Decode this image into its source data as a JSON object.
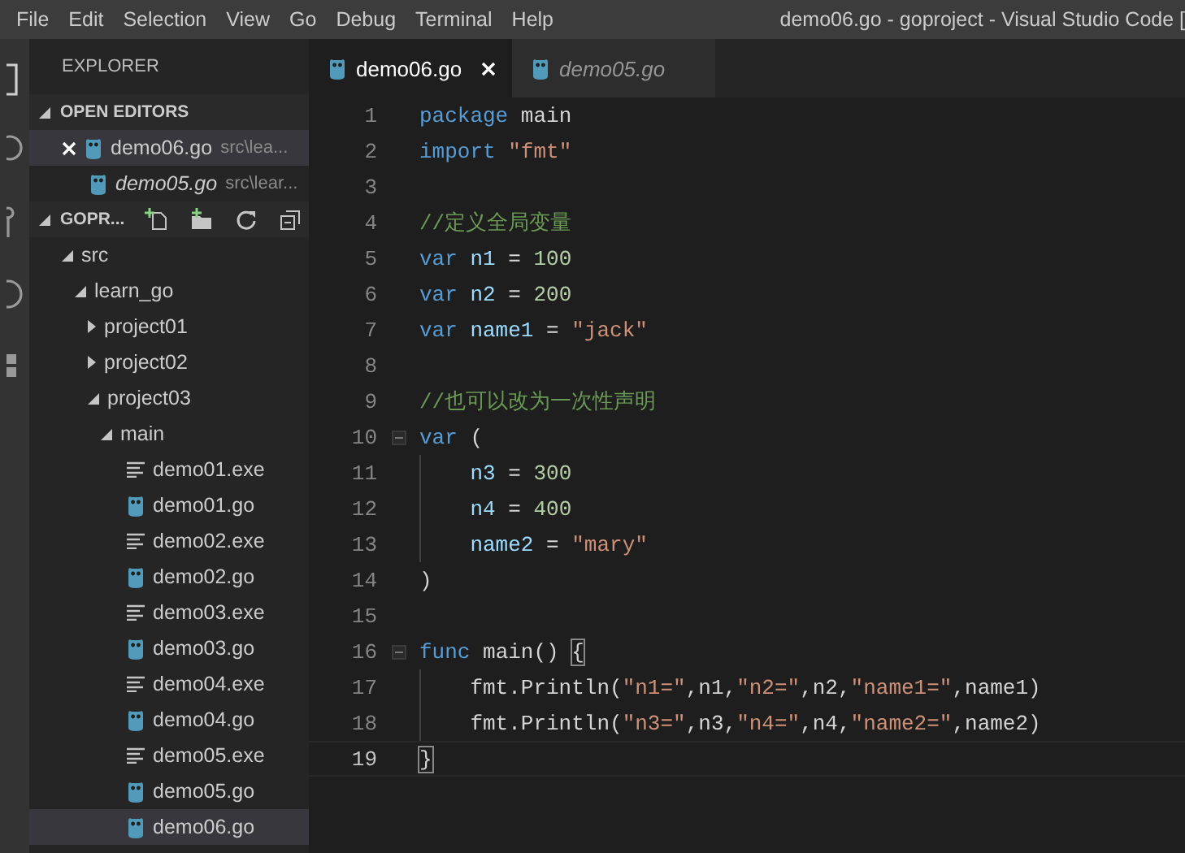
{
  "menu": [
    "File",
    "Edit",
    "Selection",
    "View",
    "Go",
    "Debug",
    "Terminal",
    "Help"
  ],
  "window": {
    "title": "demo06.go - goproject - Visual Studio Code ["
  },
  "sidebar": {
    "title": "EXPLORER",
    "open_editors": {
      "title": "OPEN EDITORS",
      "expanded": true,
      "items": [
        {
          "name": "demo06.go",
          "path": "src\\lea...",
          "selected": true,
          "preview": false
        },
        {
          "name": "demo05.go",
          "path": "src\\lear...",
          "selected": false,
          "preview": true
        }
      ]
    },
    "folder": {
      "title": "GOPR...",
      "expanded": true,
      "tree": [
        {
          "name": "src",
          "kind": "folder",
          "expanded": true,
          "selected": false,
          "children": [
            {
              "name": "learn_go",
              "kind": "folder",
              "expanded": true,
              "selected": false,
              "children": [
                {
                  "name": "project01",
                  "kind": "folder",
                  "expanded": false,
                  "selected": false
                },
                {
                  "name": "project02",
                  "kind": "folder",
                  "expanded": false,
                  "selected": false
                },
                {
                  "name": "project03",
                  "kind": "folder",
                  "expanded": true,
                  "selected": false,
                  "children": [
                    {
                      "name": "main",
                      "kind": "folder",
                      "expanded": true,
                      "selected": false,
                      "children": [
                        {
                          "name": "demo01.exe",
                          "kind": "exe",
                          "selected": false
                        },
                        {
                          "name": "demo01.go",
                          "kind": "go",
                          "selected": false
                        },
                        {
                          "name": "demo02.exe",
                          "kind": "exe",
                          "selected": false
                        },
                        {
                          "name": "demo02.go",
                          "kind": "go",
                          "selected": false
                        },
                        {
                          "name": "demo03.exe",
                          "kind": "exe",
                          "selected": false
                        },
                        {
                          "name": "demo03.go",
                          "kind": "go",
                          "selected": false
                        },
                        {
                          "name": "demo04.exe",
                          "kind": "exe",
                          "selected": false
                        },
                        {
                          "name": "demo04.go",
                          "kind": "go",
                          "selected": false
                        },
                        {
                          "name": "demo05.exe",
                          "kind": "exe",
                          "selected": false
                        },
                        {
                          "name": "demo05.go",
                          "kind": "go",
                          "selected": false
                        },
                        {
                          "name": "demo06.go",
                          "kind": "go",
                          "selected": true
                        }
                      ]
                    }
                  ]
                }
              ]
            }
          ]
        }
      ]
    }
  },
  "tabs": [
    {
      "label": "demo06.go",
      "selected": true,
      "preview": false
    },
    {
      "label": "demo05.go",
      "selected": false,
      "preview": true
    }
  ],
  "editor": {
    "lines": [
      {
        "number": "1",
        "tokens": [
          {
            "kind": "keyword",
            "text": "package"
          },
          {
            "kind": "plain",
            "text": " main"
          }
        ]
      },
      {
        "number": "2",
        "tokens": [
          {
            "kind": "keyword",
            "text": "import"
          },
          {
            "kind": "string",
            "text": " \"fmt\""
          }
        ]
      },
      {
        "number": "3"
      },
      {
        "number": "4",
        "tokens": [
          {
            "kind": "comment",
            "text": "//定义全局变量"
          }
        ]
      },
      {
        "number": "5",
        "tokens": [
          {
            "kind": "keyword",
            "text": "var"
          },
          {
            "kind": "ident",
            "text": " n1"
          },
          {
            "kind": "plain",
            "text": " = "
          },
          {
            "kind": "number",
            "text": "100"
          }
        ]
      },
      {
        "number": "6",
        "tokens": [
          {
            "kind": "keyword",
            "text": "var"
          },
          {
            "kind": "ident",
            "text": " n2"
          },
          {
            "kind": "plain",
            "text": " = "
          },
          {
            "kind": "number",
            "text": "200"
          }
        ]
      },
      {
        "number": "7",
        "tokens": [
          {
            "kind": "keyword",
            "text": "var"
          },
          {
            "kind": "ident",
            "text": " name1"
          },
          {
            "kind": "plain",
            "text": " = "
          },
          {
            "kind": "string",
            "text": "\"jack\""
          }
        ]
      },
      {
        "number": "8"
      },
      {
        "number": "9",
        "tokens": [
          {
            "kind": "comment",
            "text": "//也可以改为一次性声明"
          }
        ]
      },
      {
        "number": "10",
        "foldable": true,
        "tokens": [
          {
            "kind": "keyword",
            "text": "var"
          },
          {
            "kind": "plain",
            "text": " ("
          }
        ]
      },
      {
        "number": "11",
        "guide": true,
        "tokens": [
          {
            "kind": "ident",
            "text": "n3"
          },
          {
            "kind": "plain",
            "text": " = "
          },
          {
            "kind": "number",
            "text": "300"
          }
        ]
      },
      {
        "number": "12",
        "guide": true,
        "tokens": [
          {
            "kind": "ident",
            "text": "n4"
          },
          {
            "kind": "plain",
            "text": " = "
          },
          {
            "kind": "number",
            "text": "400"
          }
        ]
      },
      {
        "number": "13",
        "guide": true,
        "tokens": [
          {
            "kind": "ident",
            "text": "name2"
          },
          {
            "kind": "plain",
            "text": " = "
          },
          {
            "kind": "string",
            "text": "\"mary\""
          }
        ]
      },
      {
        "number": "14",
        "tokens": [
          {
            "kind": "plain",
            "text": ")"
          }
        ]
      },
      {
        "number": "15"
      },
      {
        "number": "16",
        "foldable": true,
        "tokens": [
          {
            "kind": "keyword",
            "text": "func"
          },
          {
            "kind": "plain",
            "text": " main() "
          },
          {
            "kind": "bracket",
            "text": "{"
          }
        ]
      },
      {
        "number": "17",
        "guide": true,
        "tokens": [
          {
            "kind": "plain",
            "text": "fmt.Println("
          },
          {
            "kind": "string",
            "text": "\"n1=\""
          },
          {
            "kind": "plain",
            "text": ",n1,"
          },
          {
            "kind": "string",
            "text": "\"n2=\""
          },
          {
            "kind": "plain",
            "text": ",n2,"
          },
          {
            "kind": "string",
            "text": "\"name1=\""
          },
          {
            "kind": "plain",
            "text": ",name1)"
          }
        ]
      },
      {
        "number": "18",
        "guide": true,
        "tokens": [
          {
            "kind": "plain",
            "text": "fmt.Println("
          },
          {
            "kind": "string",
            "text": "\"n3=\""
          },
          {
            "kind": "plain",
            "text": ",n3,"
          },
          {
            "kind": "string",
            "text": "\"n4=\""
          },
          {
            "kind": "plain",
            "text": ",n4,"
          },
          {
            "kind": "string",
            "text": "\"name2=\""
          },
          {
            "kind": "plain",
            "text": ",name2)"
          }
        ]
      },
      {
        "number": "19",
        "current": true,
        "tokens": [
          {
            "kind": "bracket",
            "text": "}"
          }
        ]
      }
    ]
  }
}
